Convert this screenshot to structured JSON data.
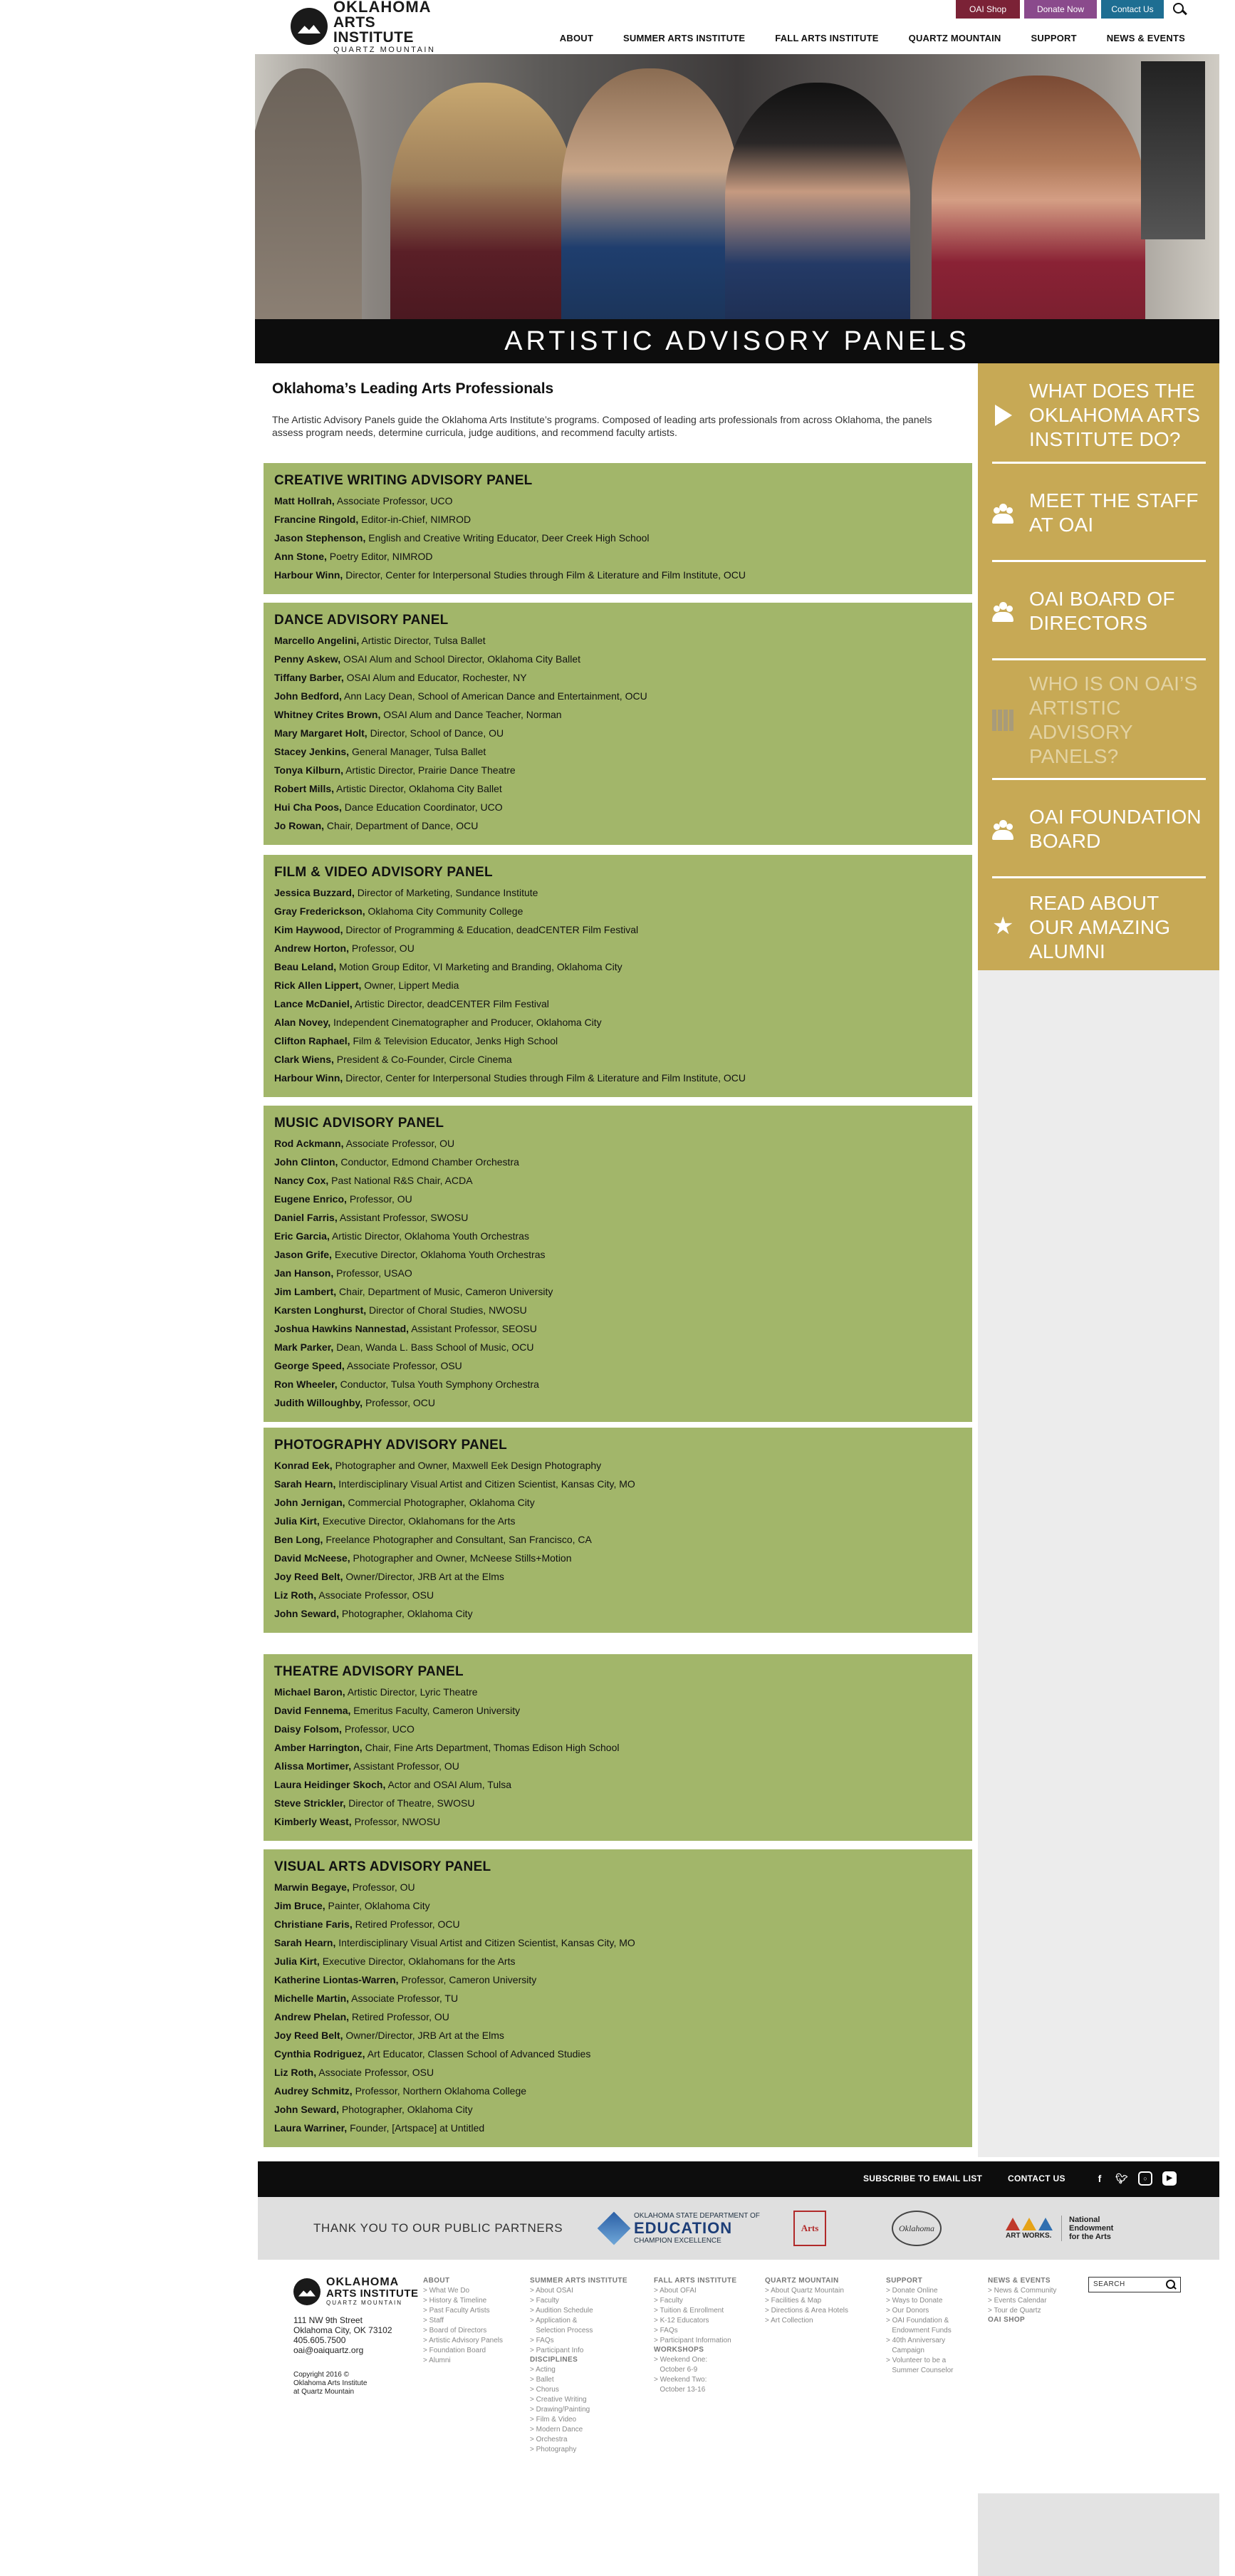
{
  "header": {
    "logo": {
      "line1": "OKLAHOMA",
      "line2": "ARTS INSTITUTE",
      "line3": "QUARTZ MOUNTAIN"
    },
    "util_buttons": {
      "shop": "OAI Shop",
      "donate": "Donate Now",
      "contact": "Contact Us"
    },
    "nav": [
      "ABOUT",
      "SUMMER ARTS INSTITUTE",
      "FALL ARTS INSTITUTE",
      "QUARTZ MOUNTAIN",
      "SUPPORT",
      "NEWS & EVENTS"
    ]
  },
  "hero": {
    "title": "ARTISTIC ADVISORY PANELS"
  },
  "intro": {
    "title": "Oklahoma’s Leading Arts Professionals",
    "text": "The Artistic Advisory Panels guide the Oklahoma Arts Institute’s programs. Composed of leading arts professionals from across Oklahoma, the panels assess program needs, determine curricula, judge auditions, and recommend faculty artists."
  },
  "panels": [
    {
      "title": "CREATIVE WRITING ADVISORY PANEL",
      "members": [
        {
          "name": "Matt Hollrah,",
          "role": "Associate Professor, UCO"
        },
        {
          "name": "Francine Ringold,",
          "role": "Editor-in-Chief, NIMROD"
        },
        {
          "name": "Jason Stephenson,",
          "role": "English and Creative Writing Educator, Deer Creek High School"
        },
        {
          "name": "Ann Stone,",
          "role": "Poetry Editor, NIMROD"
        },
        {
          "name": "Harbour Winn,",
          "role": "Director, Center for Interpersonal Studies through Film & Literature and Film Institute, OCU"
        }
      ]
    },
    {
      "title": "DANCE ADVISORY PANEL",
      "members": [
        {
          "name": "Marcello Angelini,",
          "role": "Artistic Director, Tulsa Ballet"
        },
        {
          "name": "Penny Askew,",
          "role": "OSAI Alum and School Director, Oklahoma City Ballet"
        },
        {
          "name": "Tiffany Barber,",
          "role": "OSAI Alum and Educator, Rochester, NY"
        },
        {
          "name": "John Bedford,",
          "role": "Ann Lacy Dean, School of American Dance and Entertainment, OCU"
        },
        {
          "name": "Whitney Crites Brown,",
          "role": "OSAI Alum and Dance Teacher, Norman"
        },
        {
          "name": "Mary Margaret Holt,",
          "role": "Director, School of Dance, OU"
        },
        {
          "name": "Stacey Jenkins,",
          "role": "General Manager, Tulsa Ballet"
        },
        {
          "name": "Tonya Kilburn,",
          "role": "Artistic Director, Prairie Dance Theatre"
        },
        {
          "name": "Robert Mills,",
          "role": "Artistic Director, Oklahoma City Ballet"
        },
        {
          "name": "Hui Cha Poos,",
          "role": "Dance Education Coordinator, UCO"
        },
        {
          "name": "Jo Rowan,",
          "role": "Chair, Department of Dance, OCU"
        }
      ]
    },
    {
      "title": "FILM & VIDEO ADVISORY PANEL",
      "members": [
        {
          "name": "Jessica Buzzard,",
          "role": "Director of Marketing, Sundance Institute"
        },
        {
          "name": "Gray Frederickson,",
          "role": "Oklahoma City Community College"
        },
        {
          "name": "Kim Haywood,",
          "role": "Director of Programming & Education, deadCENTER Film Festival"
        },
        {
          "name": "Andrew Horton,",
          "role": "Professor, OU"
        },
        {
          "name": "Beau Leland,",
          "role": "Motion Group Editor, VI Marketing and Branding, Oklahoma City"
        },
        {
          "name": "Rick Allen Lippert,",
          "role": "Owner, Lippert Media"
        },
        {
          "name": "Lance McDaniel,",
          "role": "Artistic Director, deadCENTER Film Festival"
        },
        {
          "name": "Alan Novey,",
          "role": "Independent Cinematographer and Producer, Oklahoma City"
        },
        {
          "name": "Clifton Raphael,",
          "role": "Film & Television Educator, Jenks High School"
        },
        {
          "name": "Clark Wiens,",
          "role": "President & Co-Founder, Circle Cinema"
        },
        {
          "name": "Harbour Winn,",
          "role": "Director, Center for Interpersonal Studies through Film & Literature and Film Institute, OCU"
        }
      ]
    },
    {
      "title": "MUSIC ADVISORY PANEL",
      "members": [
        {
          "name": "Rod Ackmann,",
          "role": "Associate Professor, OU"
        },
        {
          "name": "John Clinton,",
          "role": "Conductor, Edmond Chamber Orchestra"
        },
        {
          "name": "Nancy Cox,",
          "role": "Past National R&S Chair, ACDA"
        },
        {
          "name": "Eugene Enrico,",
          "role": "Professor, OU"
        },
        {
          "name": "Daniel Farris,",
          "role": "Assistant Professor, SWOSU"
        },
        {
          "name": "Eric Garcia,",
          "role": "Artistic Director, Oklahoma Youth Orchestras"
        },
        {
          "name": "Jason Grife,",
          "role": "Executive Director, Oklahoma Youth Orchestras"
        },
        {
          "name": "Jan Hanson,",
          "role": "Professor, USAO"
        },
        {
          "name": "Jim Lambert,",
          "role": "Chair, Department of Music, Cameron University"
        },
        {
          "name": "Karsten Longhurst,",
          "role": "Director of Choral Studies, NWOSU"
        },
        {
          "name": "Joshua Hawkins Nannestad,",
          "role": "Assistant Professor, SEOSU"
        },
        {
          "name": "Mark Parker,",
          "role": "Dean, Wanda L. Bass School of Music, OCU"
        },
        {
          "name": "George Speed,",
          "role": "Associate Professor, OSU"
        },
        {
          "name": "Ron Wheeler,",
          "role": "Conductor, Tulsa Youth Symphony Orchestra"
        },
        {
          "name": "Judith Willoughby,",
          "role": "Professor, OCU"
        }
      ]
    },
    {
      "title": "PHOTOGRAPHY ADVISORY PANEL",
      "members": [
        {
          "name": "Konrad Eek,",
          "role": "Photographer and Owner, Maxwell Eek Design Photography"
        },
        {
          "name": "Sarah Hearn,",
          "role": "Interdisciplinary Visual Artist and Citizen Scientist, Kansas City, MO"
        },
        {
          "name": "John Jernigan,",
          "role": "Commercial Photographer, Oklahoma City"
        },
        {
          "name": "Julia Kirt,",
          "role": "Executive Director, Oklahomans for the Arts"
        },
        {
          "name": "Ben Long,",
          "role": "Freelance Photographer and Consultant, San Francisco, CA"
        },
        {
          "name": "David McNeese,",
          "role": "Photographer and Owner, McNeese Stills+Motion"
        },
        {
          "name": "Joy Reed Belt,",
          "role": "Owner/Director, JRB Art at the Elms"
        },
        {
          "name": "Liz Roth,",
          "role": "Associate Professor, OSU"
        },
        {
          "name": "John Seward,",
          "role": "Photographer, Oklahoma City"
        }
      ]
    },
    {
      "title": "THEATRE ADVISORY PANEL",
      "members": [
        {
          "name": "Michael Baron,",
          "role": "Artistic Director, Lyric Theatre"
        },
        {
          "name": "David Fennema,",
          "role": "Emeritus Faculty, Cameron University"
        },
        {
          "name": "Daisy Folsom,",
          "role": "Professor, UCO"
        },
        {
          "name": "Amber Harrington,",
          "role": "Chair, Fine Arts Department, Thomas Edison High School"
        },
        {
          "name": "Alissa Mortimer,",
          "role": "Assistant Professor, OU"
        },
        {
          "name": "Laura Heidinger Skoch,",
          "role": "Actor and OSAI Alum, Tulsa"
        },
        {
          "name": "Steve Strickler,",
          "role": "Director of Theatre, SWOSU"
        },
        {
          "name": "Kimberly Weast,",
          "role": "Professor, NWOSU"
        }
      ]
    },
    {
      "title": "VISUAL ARTS ADVISORY PANEL",
      "members": [
        {
          "name": "Marwin Begaye,",
          "role": "Professor, OU"
        },
        {
          "name": "Jim Bruce,",
          "role": "Painter, Oklahoma City"
        },
        {
          "name": "Christiane Faris,",
          "role": "Retired Professor, OCU"
        },
        {
          "name": "Sarah Hearn,",
          "role": "Interdisciplinary Visual Artist and Citizen Scientist, Kansas City, MO"
        },
        {
          "name": "Julia Kirt,",
          "role": "Executive Director, Oklahomans for the Arts"
        },
        {
          "name": "Katherine Liontas-Warren,",
          "role": "Professor, Cameron University"
        },
        {
          "name": "Michelle Martin,",
          "role": "Associate Professor, TU"
        },
        {
          "name": "Andrew Phelan,",
          "role": "Retired Professor, OU"
        },
        {
          "name": "Joy Reed Belt,",
          "role": "Owner/Director, JRB Art at the Elms"
        },
        {
          "name": "Cynthia Rodriguez,",
          "role": "Art Educator, Classen School of Advanced Studies"
        },
        {
          "name": "Liz Roth,",
          "role": "Associate Professor, OSU"
        },
        {
          "name": "Audrey Schmitz,",
          "role": "Professor, Northern Oklahoma College"
        },
        {
          "name": "John Seward,",
          "role": "Photographer, Oklahoma City"
        },
        {
          "name": "Laura Warriner,",
          "role": "Founder, [Artspace] at Untitled"
        }
      ]
    }
  ],
  "sidebar": {
    "items": [
      {
        "label": "WHAT DOES THE OKLAHOMA ARTS INSTITUTE DO?",
        "icon": "play-icon"
      },
      {
        "label": "MEET THE STAFF AT OAI",
        "icon": "people-icon"
      },
      {
        "label": "OAI BOARD OF DIRECTORS",
        "icon": "people-icon"
      },
      {
        "label": "WHO IS ON OAI’S ARTISTIC ADVISORY PANELS?",
        "icon": "panels-icon"
      },
      {
        "label": "OAI FOUNDATION BOARD",
        "icon": "people-icon"
      },
      {
        "label": "READ ABOUT OUR AMAZING ALUMNI",
        "icon": "star-icon"
      }
    ]
  },
  "footer_bar": {
    "subscribe": "SUBSCRIBE TO EMAIL LIST",
    "contact": "CONTACT US"
  },
  "partners": {
    "label": "THANK YOU TO OUR PUBLIC PARTNERS",
    "education_top": "OKLAHOMA STATE DEPARTMENT OF",
    "education_main": "EDUCATION",
    "education_sub": "CHAMPION EXCELLENCE",
    "arts_council": "Arts",
    "oklahoma": "Oklahoma",
    "art_works": "ART WORKS.",
    "nea_line1": "National",
    "nea_line2": "Endowment",
    "nea_line3": "for the Arts"
  },
  "footer": {
    "logo": {
      "line1": "OKLAHOMA",
      "line2": "ARTS INSTITUTE",
      "line3": "QUARTZ MOUNTAIN"
    },
    "address_line1": "111 NW 9th Street",
    "address_line2": "Oklahoma City, OK 73102",
    "phone": "405.605.7500",
    "email": "oai@oaiquartz.org",
    "copy_line1": "Copyright 2016 ©",
    "copy_line2": "Oklahoma Arts Institute",
    "copy_line3": "at Quartz Mountain",
    "columns": [
      {
        "heading": "ABOUT",
        "links": [
          "> What We Do",
          "> History & Timeline",
          "> Past Faculty Artists",
          "> Staff",
          "> Board of Directors",
          "> Artistic Advisory Panels",
          "> Foundation Board",
          "> Alumni"
        ]
      },
      {
        "heading": "SUMMER ARTS INSTITUTE",
        "links": [
          "> About OSAI",
          "> Faculty",
          "> Audition Schedule",
          "> Application &",
          "   Selection Process",
          "> FAQs",
          "> Participant Info"
        ],
        "heading2": "DISCIPLINES",
        "links2": [
          "> Acting",
          "> Ballet",
          "> Chorus",
          "> Creative Writing",
          "> Drawing/Painting",
          "> Film & Video",
          "> Modern Dance",
          "> Orchestra",
          "> Photography"
        ]
      },
      {
        "heading": "FALL ARTS INSTITUTE",
        "links": [
          "> About OFAI",
          "> Faculty",
          "> Tuition & Enrollment",
          "> K-12 Educators",
          "> FAQs",
          "> Participant Information"
        ],
        "heading2": "WORKSHOPS",
        "links2": [
          "> Weekend One:",
          "   October 6-9",
          "> Weekend Two:",
          "   October 13-16"
        ]
      },
      {
        "heading": "QUARTZ MOUNTAIN",
        "links": [
          "> About Quartz Mountain",
          "> Facilities & Map",
          "> Directions & Area Hotels",
          "> Art Collection"
        ]
      },
      {
        "heading": "SUPPORT",
        "links": [
          "> Donate Online",
          "> Ways to Donate",
          "> Our Donors",
          "> OAI Foundation &",
          "   Endowment Funds",
          "> 40th Anniversary",
          "   Campaign",
          "> Volunteer to be a",
          "   Summer Counselor"
        ]
      },
      {
        "heading": "NEWS & EVENTS",
        "links": [
          "> News & Community",
          "> Events Calendar",
          "> Tour de Quartz"
        ],
        "heading2": "OAI SHOP",
        "links2": []
      }
    ],
    "search_placeholder": "SEARCH"
  }
}
